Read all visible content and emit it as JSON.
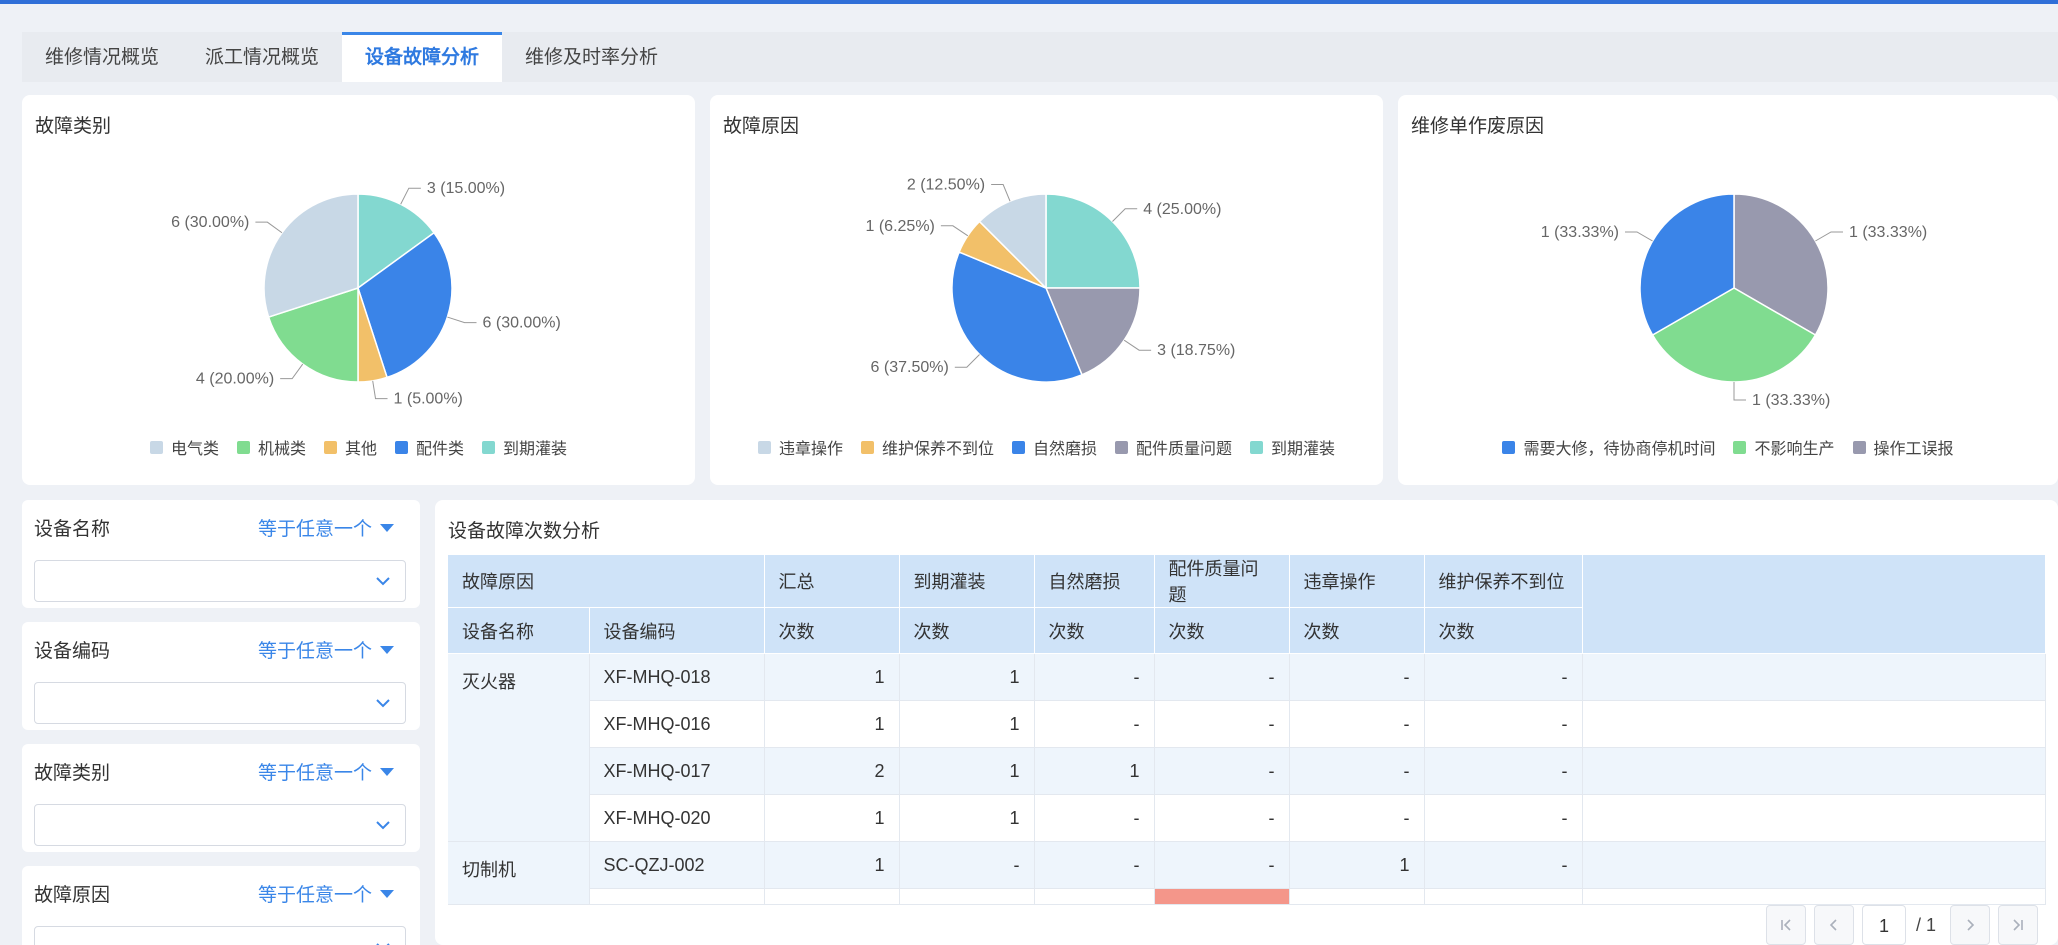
{
  "tabs": [
    {
      "label": "维修情况概览",
      "active": false
    },
    {
      "label": "派工情况概览",
      "active": false
    },
    {
      "label": "设备故障分析",
      "active": true
    },
    {
      "label": "维修及时率分析",
      "active": false
    }
  ],
  "colors": {
    "accent": "#3a86e8",
    "header_bg": "#cfe3f8",
    "highlight_cell": "#f4968a"
  },
  "chart_data": [
    {
      "type": "pie",
      "title": "故障类别",
      "slices": [
        {
          "label": "到期灌装",
          "value": 3,
          "percent": "15.00%",
          "color": "#83d8d0"
        },
        {
          "label": "配件类",
          "value": 6,
          "percent": "30.00%",
          "color": "#3a84e8"
        },
        {
          "label": "其他",
          "value": 1,
          "percent": "5.00%",
          "color": "#f2c069"
        },
        {
          "label": "机械类",
          "value": 4,
          "percent": "20.00%",
          "color": "#80dc90"
        },
        {
          "label": "电气类",
          "value": 6,
          "percent": "30.00%",
          "color": "#c8d8e6"
        }
      ],
      "slice_labels": [
        "3 (15.00%)",
        "6 (30.00%)",
        "1 (5.00%)",
        "4 (20.00%)",
        "6 (30.00%)"
      ],
      "legend": [
        "电气类",
        "机械类",
        "其他",
        "配件类",
        "到期灌装"
      ],
      "legend_colors": [
        "#c8d8e6",
        "#80dc90",
        "#f2c069",
        "#3a84e8",
        "#83d8d0"
      ]
    },
    {
      "type": "pie",
      "title": "故障原因",
      "slices": [
        {
          "label": "到期灌装",
          "value": 4,
          "percent": "25.00%",
          "color": "#83d8d0"
        },
        {
          "label": "配件质量问题",
          "value": 3,
          "percent": "18.75%",
          "color": "#9899ae"
        },
        {
          "label": "自然磨损",
          "value": 6,
          "percent": "37.50%",
          "color": "#3a84e8"
        },
        {
          "label": "维护保养不到位",
          "value": 1,
          "percent": "6.25%",
          "color": "#f2c069"
        },
        {
          "label": "违章操作",
          "value": 2,
          "percent": "12.50%",
          "color": "#c8d8e6"
        }
      ],
      "slice_labels": [
        "4 (25.00%)",
        "3 (18.75%)",
        "6 (37.50%)",
        "1 (6.25%)",
        "2 (12.50%)"
      ],
      "legend": [
        "违章操作",
        "维护保养不到位",
        "自然磨损",
        "配件质量问题",
        "到期灌装"
      ],
      "legend_colors": [
        "#c8d8e6",
        "#f2c069",
        "#3a84e8",
        "#9899ae",
        "#83d8d0"
      ]
    },
    {
      "type": "pie",
      "title": "维修单作废原因",
      "slices": [
        {
          "label": "操作工误报",
          "value": 1,
          "percent": "33.33%",
          "color": "#9899ae"
        },
        {
          "label": "不影响生产",
          "value": 1,
          "percent": "33.33%",
          "color": "#80dc90"
        },
        {
          "label": "需要大修，待协商停机时间",
          "value": 1,
          "percent": "33.33%",
          "color": "#3a84e8"
        }
      ],
      "slice_labels": [
        "1 (33.33%)",
        "1 (33.33%)",
        "1 (33.33%)"
      ],
      "legend": [
        "需要大修，待协商停机时间",
        "不影响生产",
        "操作工误报"
      ],
      "legend_colors": [
        "#3a84e8",
        "#80dc90",
        "#9899ae"
      ]
    }
  ],
  "filters": [
    {
      "label": "设备名称",
      "operator": "等于任意一个"
    },
    {
      "label": "设备编码",
      "operator": "等于任意一个"
    },
    {
      "label": "故障类别",
      "operator": "等于任意一个"
    },
    {
      "label": "故障原因",
      "operator": "等于任意一个"
    }
  ],
  "table": {
    "title": "设备故障次数分析",
    "header1": [
      "故障原因",
      "汇总",
      "到期灌装",
      "自然磨损",
      "配件质量问题",
      "违章操作",
      "维护保养不到位"
    ],
    "header2": [
      "设备名称",
      "设备编码",
      "次数",
      "次数",
      "次数",
      "次数",
      "次数",
      "次数"
    ],
    "rows": [
      {
        "name": "灭火器",
        "code": "XF-MHQ-018",
        "vals": [
          "1",
          "1",
          "-",
          "-",
          "-",
          "-"
        ]
      },
      {
        "name": "",
        "code": "XF-MHQ-016",
        "vals": [
          "1",
          "1",
          "-",
          "-",
          "-",
          "-"
        ]
      },
      {
        "name": "",
        "code": "XF-MHQ-017",
        "vals": [
          "2",
          "1",
          "1",
          "-",
          "-",
          "-"
        ]
      },
      {
        "name": "",
        "code": "XF-MHQ-020",
        "vals": [
          "1",
          "1",
          "-",
          "-",
          "-",
          "-"
        ]
      },
      {
        "name": "切制机",
        "code": "SC-QZJ-002",
        "vals": [
          "1",
          "-",
          "-",
          "-",
          "1",
          "-"
        ]
      }
    ]
  },
  "pager": {
    "current": "1",
    "total": "/ 1"
  }
}
